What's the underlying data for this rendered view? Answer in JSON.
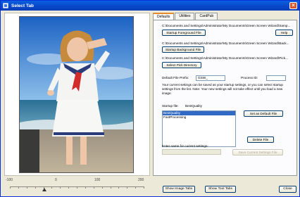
{
  "window": {
    "title": "Select Tab"
  },
  "slider": {
    "labels": [
      "-100",
      "0",
      "100",
      "200"
    ]
  },
  "tabs": [
    "Defaults",
    "Utilities",
    "CardPub"
  ],
  "defaults": {
    "foreground_path": "C:\\Documents and Settings\\Administrator\\My Documents\\Green Screen Wizard\\Samp...",
    "foreground_button": "Startup Foreground File",
    "help_button": "Help",
    "background_path": "C:\\Documents and Settings\\Administrator\\My Documents\\Green Screen Wizard\\Back...",
    "background_button": "Startup Background File",
    "pick_path": "C:\\Documents and Settings\\Administrator\\My Documents\\Green Screen Wizard\\Pick...",
    "pick_button": "Select Pick Directory",
    "prefix_label": "Default File Prefix:",
    "prefix_value": "GSW_",
    "process_id_label": "Process ID:",
    "process_id_value": "",
    "note": "Your current settings can be saved as your startup settings, or you can select startup settings from the list. Note: Your new settings will not take effect until you load a new image.",
    "startup_file_label": "Startup file:",
    "startup_file_value": "BestQuality",
    "settings_list": [
      "BestQuality",
      "FastProcessing"
    ],
    "selected_index": 0,
    "set_default_button": "Set as Default File",
    "delete_button": "Delete File",
    "enter_name_label": "Enter name for current settings:",
    "name_value": "",
    "save_button": "Save Current Settings File"
  },
  "footer": {
    "show_image_tabs": "Show Image Tabs",
    "show_tool_tabs": "Show Tool Tabs",
    "close": "Close"
  },
  "colors": {
    "title_bar": "#0746c6",
    "selection": "#316ac5",
    "active_tab_accent": "#e68b2c"
  }
}
